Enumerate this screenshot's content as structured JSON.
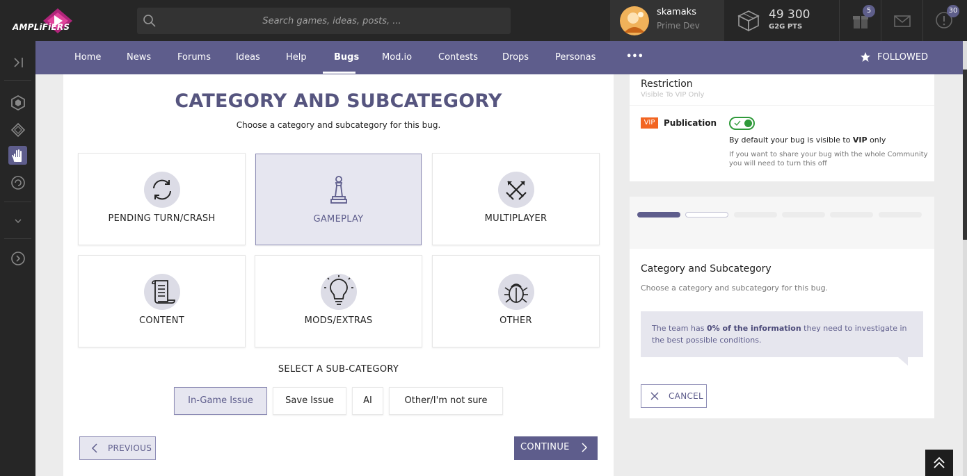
{
  "header": {
    "logo_text": "AMPLiFiERS",
    "search_placeholder": "Search games, ideas, posts, ...",
    "user": {
      "name": "skamaks",
      "role": "Prime Dev"
    },
    "points": {
      "value": "49 300",
      "label": "G2G PTS"
    },
    "badges": {
      "gifts": "5",
      "notifications": "30"
    }
  },
  "nav": {
    "items": [
      "Home",
      "News",
      "Forums",
      "Ideas",
      "Help",
      "Bugs",
      "Mod.io",
      "Contests",
      "Drops",
      "Personas"
    ],
    "more": "•••",
    "active": "Bugs",
    "followed": "FOLLOWED"
  },
  "main": {
    "title": "CATEGORY AND SUBCATEGORY",
    "subtitle": "Choose a category and subcategory for this bug.",
    "categories": [
      {
        "label": "PENDING TURN/CRASH",
        "icon": "sync-icon",
        "selected": false
      },
      {
        "label": "GAMEPLAY",
        "icon": "pawn-icon",
        "selected": true
      },
      {
        "label": "MULTIPLAYER",
        "icon": "crossed-swords-icon",
        "selected": false
      },
      {
        "label": "CONTENT",
        "icon": "scroll-icon",
        "selected": false
      },
      {
        "label": "MODS/EXTRAS",
        "icon": "lightbulb-icon",
        "selected": false
      },
      {
        "label": "OTHER",
        "icon": "bug-icon",
        "selected": false
      }
    ],
    "subcategory_title": "SELECT A SUB-CATEGORY",
    "subcategories": [
      {
        "label": "In-Game Issue",
        "selected": true
      },
      {
        "label": "Save Issue",
        "selected": false
      },
      {
        "label": "AI",
        "selected": false
      },
      {
        "label": "Other/I'm not sure",
        "selected": false
      }
    ],
    "previous_label": "PREVIOUS",
    "continue_label": "CONTINUE"
  },
  "restriction": {
    "title": "Restriction",
    "subtitle": "Visible To VIP Only",
    "vip_tag": "VIP",
    "publication_label": "Publication",
    "toggle_on": true,
    "default_text_prefix": "By default your bug is visible to ",
    "default_text_bold": "VIP",
    "default_text_suffix": " only",
    "note": "If you want to share your bug with the whole Community you will need to turn this off"
  },
  "progress": {
    "total_steps": 6,
    "current_step": 2,
    "title": "Category and Subcategory",
    "subtitle": "Choose a category and subcategory for this bug.",
    "info_prefix": "The team has ",
    "info_bold": "0% of the information",
    "info_suffix": " they need to investigate in the best possible conditions.",
    "cancel_label": "CANCEL"
  },
  "colors": {
    "accent": "#5e5d8c",
    "topbar": "#262626",
    "vip": "#f26522",
    "toggle": "#2f9a3a"
  }
}
